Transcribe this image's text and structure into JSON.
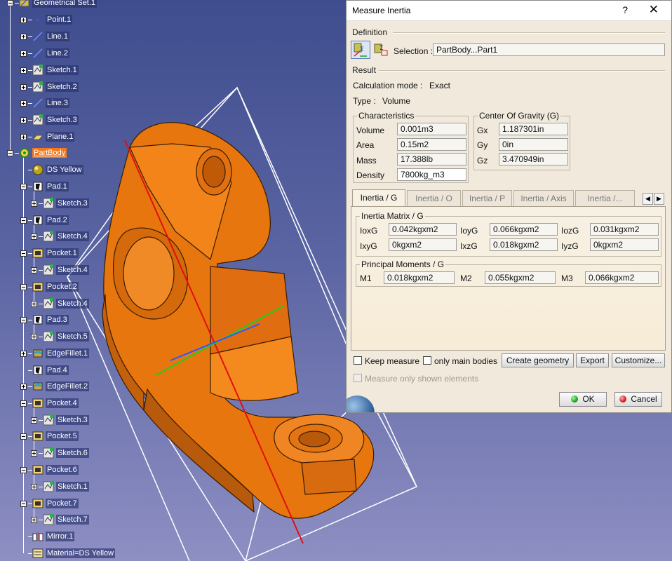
{
  "tree": {
    "items": [
      {
        "label": "Geometrical Set.1",
        "icon": "geometrical-set-icon"
      },
      {
        "label": "Point.1",
        "icon": "point-icon"
      },
      {
        "label": "Line.1",
        "icon": "line-icon"
      },
      {
        "label": "Line.2",
        "icon": "line-icon"
      },
      {
        "label": "Sketch.1",
        "icon": "sketch-icon"
      },
      {
        "label": "Sketch.2",
        "icon": "sketch-icon"
      },
      {
        "label": "Line.3",
        "icon": "line-icon"
      },
      {
        "label": "Sketch.3",
        "icon": "sketch-icon"
      },
      {
        "label": "Plane.1",
        "icon": "plane-icon"
      },
      {
        "label": "PartBody",
        "icon": "partbody-icon"
      },
      {
        "label": "DS Yellow",
        "icon": "material-sphere-icon"
      },
      {
        "label": "Pad.1",
        "icon": "pad-icon"
      },
      {
        "label": "Sketch.3",
        "icon": "sketch-icon"
      },
      {
        "label": "Pad.2",
        "icon": "pad-icon"
      },
      {
        "label": "Sketch.4",
        "icon": "sketch-icon"
      },
      {
        "label": "Pocket.1",
        "icon": "pocket-icon"
      },
      {
        "label": "Sketch.4",
        "icon": "sketch-icon"
      },
      {
        "label": "Pocket.2",
        "icon": "pocket-icon"
      },
      {
        "label": "Sketch.4",
        "icon": "sketch-icon"
      },
      {
        "label": "Pad.3",
        "icon": "pad-icon"
      },
      {
        "label": "Sketch.5",
        "icon": "sketch-icon"
      },
      {
        "label": "EdgeFillet.1",
        "icon": "edge-fillet-icon"
      },
      {
        "label": "Pad.4",
        "icon": "pad-icon"
      },
      {
        "label": "EdgeFillet.2",
        "icon": "edge-fillet-icon"
      },
      {
        "label": "Pocket.4",
        "icon": "pocket-icon"
      },
      {
        "label": "Sketch.3",
        "icon": "sketch-icon"
      },
      {
        "label": "Pocket.5",
        "icon": "pocket-icon"
      },
      {
        "label": "Sketch.6",
        "icon": "sketch-icon"
      },
      {
        "label": "Pocket.6",
        "icon": "pocket-icon"
      },
      {
        "label": "Sketch.1",
        "icon": "sketch-icon"
      },
      {
        "label": "Pocket.7",
        "icon": "pocket-icon"
      },
      {
        "label": "Sketch.7",
        "icon": "sketch-icon"
      },
      {
        "label": "Mirror.1",
        "icon": "mirror-icon"
      },
      {
        "label": "Material=DS Yellow",
        "icon": "material-icon"
      }
    ]
  },
  "dialog": {
    "title": "Measure Inertia",
    "help": "?",
    "close": "✕",
    "definition": {
      "header": "Definition",
      "selection_label": "Selection :",
      "selection_value": "PartBody...Part1"
    },
    "result": {
      "header": "Result",
      "calc_mode_label": "Calculation mode :",
      "calc_mode_value": "Exact",
      "type_label": "Type :",
      "type_value": "Volume"
    },
    "characteristics": {
      "title": "Characteristics",
      "rows": [
        {
          "label": "Volume",
          "value": "0.001m3"
        },
        {
          "label": "Area",
          "value": "0.15m2"
        },
        {
          "label": "Mass",
          "value": "17.388lb"
        },
        {
          "label": "Density",
          "value": "7800kg_m3"
        }
      ]
    },
    "cog": {
      "title": "Center Of Gravity (G)",
      "rows": [
        {
          "label": "Gx",
          "value": "1.187301in"
        },
        {
          "label": "Gy",
          "value": "0in"
        },
        {
          "label": "Gz",
          "value": "3.470949in"
        }
      ]
    },
    "tabs": [
      "Inertia / G",
      "Inertia / O",
      "Inertia / P",
      "Inertia / Axis",
      "Inertia /..."
    ],
    "tab_nav": {
      "prev": "◀",
      "next": "▶"
    },
    "inertia_matrix": {
      "title": "Inertia Matrix / G",
      "cells": [
        {
          "label": "IoxG",
          "value": "0.042kgxm2"
        },
        {
          "label": "IoyG",
          "value": "0.066kgxm2"
        },
        {
          "label": "IozG",
          "value": "0.031kgxm2"
        },
        {
          "label": "IxyG",
          "value": "0kgxm2"
        },
        {
          "label": "IxzG",
          "value": "0.018kgxm2"
        },
        {
          "label": "IyzG",
          "value": "0kgxm2"
        }
      ]
    },
    "principal_moments": {
      "title": "Principal Moments / G",
      "cells": [
        {
          "label": "M1",
          "value": "0.018kgxm2"
        },
        {
          "label": "M2",
          "value": "0.055kgxm2"
        },
        {
          "label": "M3",
          "value": "0.066kgxm2"
        }
      ]
    },
    "options": {
      "keep_measure": "Keep measure",
      "only_main_bodies": "only main bodies",
      "measure_only_shown": "Measure only shown elements"
    },
    "buttons": {
      "create_geometry": "Create geometry",
      "export": "Export",
      "customize": "Customize...",
      "ok": "OK",
      "cancel": "Cancel"
    }
  },
  "colors": {
    "part_orange": "#e8760e",
    "selection_orange": "#f2781a",
    "ok_green": "#1fa51f",
    "cancel_red": "#d62020"
  }
}
